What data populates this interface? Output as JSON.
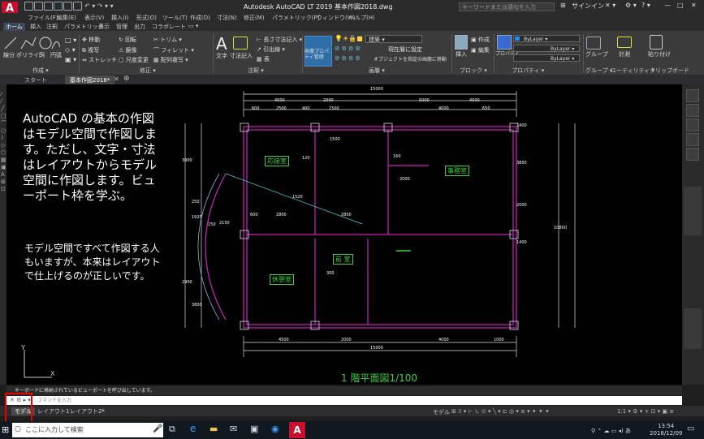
{
  "window": {
    "title": "Autodesk AutoCAD LT 2019   基本作図2018.dwg",
    "search_placeholder": "キーワードまたは語句を入力",
    "signin": "サインイン"
  },
  "menu": [
    "ファイル(F)",
    "編集(E)",
    "表示(V)",
    "挿入(I)",
    "形式(O)",
    "ツール(T)",
    "作成(D)",
    "寸法(N)",
    "修正(M)",
    "パラメトリック(P)",
    "ウィンドウ(W)",
    "ヘルプ(H)"
  ],
  "ribbon_tabs": [
    "ホーム",
    "挿入",
    "注釈",
    "パラメトリック",
    "表示",
    "管理",
    "出力",
    "コラボレート"
  ],
  "ribbon": {
    "draw": {
      "title": "作成 ▾",
      "tools": [
        "線分",
        "ポリライン",
        "円",
        "円弧"
      ]
    },
    "modify": {
      "title": "修正 ▾",
      "items": [
        "移動",
        "回転",
        "トリム",
        "複写",
        "鏡像",
        "フィレット",
        "ストレッチ",
        "尺度変更",
        "配列複写"
      ]
    },
    "annotation": {
      "title": "注釈 ▾",
      "items": [
        "文字",
        "寸法記入",
        "長さ寸法記入",
        "引出線",
        "表"
      ]
    },
    "layers": {
      "title": "画層 ▾",
      "props": "画層プロパティ管理",
      "layer_name": "建築",
      "items": [
        "現在層に設定",
        "オブジェクトを指定の画層に移動"
      ]
    },
    "block": {
      "title": "ブロック ▾",
      "items": [
        "挿入",
        "作成",
        "編集"
      ]
    },
    "properties": {
      "title": "プロパティ ▾",
      "label": "プロパティ",
      "bylayer": "ByLayer"
    },
    "groups": {
      "title": "グループ ▾",
      "label": "グループ"
    },
    "utilities": {
      "title": "ユーティリティ ▾",
      "label": "計測"
    },
    "clipboard": {
      "title": "クリップボード",
      "label": "貼り付け"
    }
  },
  "doc_tabs": [
    "スタート",
    "基本作図2018*"
  ],
  "notes": {
    "note1": "AutoCAD の基本の作図はモデル空間で作図します。ただし、文字・寸法はレイアウトからモデル空間に作図します。ビューポート枠を学ぶ。",
    "note2": "モデル空間ですべて作図する人もいますが、本来はレイアウトで仕上げるのが正しいです。"
  },
  "plan": {
    "title": "1 階平面図1/100",
    "rooms": [
      "応接室",
      "事務室",
      "前 室",
      "休憩室"
    ],
    "dims_top": [
      "15000",
      "4000",
      "2000",
      "5000",
      "4000"
    ],
    "dims_top2": [
      "600",
      "2500",
      "400",
      "1500",
      "4000",
      "650"
    ],
    "dims_bottom": [
      "4500",
      "2000",
      "4000",
      "1000"
    ],
    "dim_total": "15000",
    "dims_inner": [
      "1500",
      "2000",
      "1520",
      "2800",
      "2150",
      "600",
      "2800",
      "300",
      "120",
      "160"
    ],
    "dims_left": [
      "3900",
      "1920",
      "2900",
      "250",
      "3800",
      "150"
    ],
    "dims_right": [
      "1400",
      "3800",
      "2000",
      "1400"
    ],
    "total_right": "10800"
  },
  "command": {
    "history": "キーボードに格納されているビューポートを呼び出しています。",
    "placeholder": "コマンドを入力"
  },
  "layout_tabs": [
    "モデル",
    "レイアウト1",
    "レイアウト2",
    "+"
  ],
  "status": {
    "model": "モデル",
    "scale": "1:1"
  },
  "taskbar": {
    "search": "ここに入力して検索",
    "time": "13:54",
    "date": "2018/12/09",
    "lang": "あ"
  }
}
